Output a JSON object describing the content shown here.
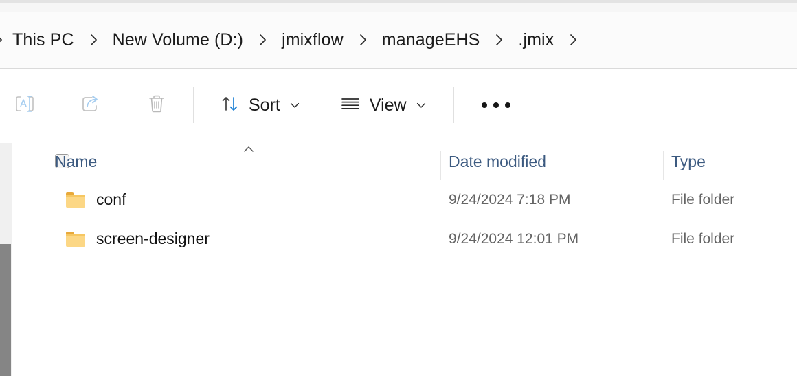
{
  "window": {
    "app": "File Explorer"
  },
  "breadcrumb": {
    "overflow_icon": "chevron-right-icon",
    "separator_icon": "chevron-right-icon",
    "items": [
      {
        "label": "This PC"
      },
      {
        "label": "New Volume (D:)"
      },
      {
        "label": "jmixflow"
      },
      {
        "label": "manageEHS"
      },
      {
        "label": ".jmix"
      }
    ]
  },
  "toolbar": {
    "rename_icon": "rename-icon",
    "share_icon": "share-icon",
    "delete_icon": "trash-icon",
    "sort_icon": "sort-arrows-icon",
    "sort_label": "Sort",
    "sort_chevron_icon": "chevron-down-icon",
    "view_icon": "view-list-icon",
    "view_label": "View",
    "view_chevron_icon": "chevron-down-icon",
    "more_icon": "ellipsis-icon"
  },
  "columns": {
    "select_all_checkbox": "checkbox-unchecked-icon",
    "sort_indicator_icon": "chevron-up-icon",
    "name": "Name",
    "date_modified": "Date modified",
    "type": "Type"
  },
  "files": [
    {
      "icon": "folder-icon",
      "name": "conf",
      "date_modified": "9/24/2024 7:18 PM",
      "type": "File folder"
    },
    {
      "icon": "folder-icon",
      "name": "screen-designer",
      "date_modified": "9/24/2024 12:01 PM",
      "type": "File folder"
    }
  ],
  "colors": {
    "header_text": "#3c5a80",
    "folder": "#fcd785",
    "folder_tab": "#e8a93a",
    "sort_arrow_accent": "#0078d4",
    "scrollbar_thumb": "#858585"
  }
}
